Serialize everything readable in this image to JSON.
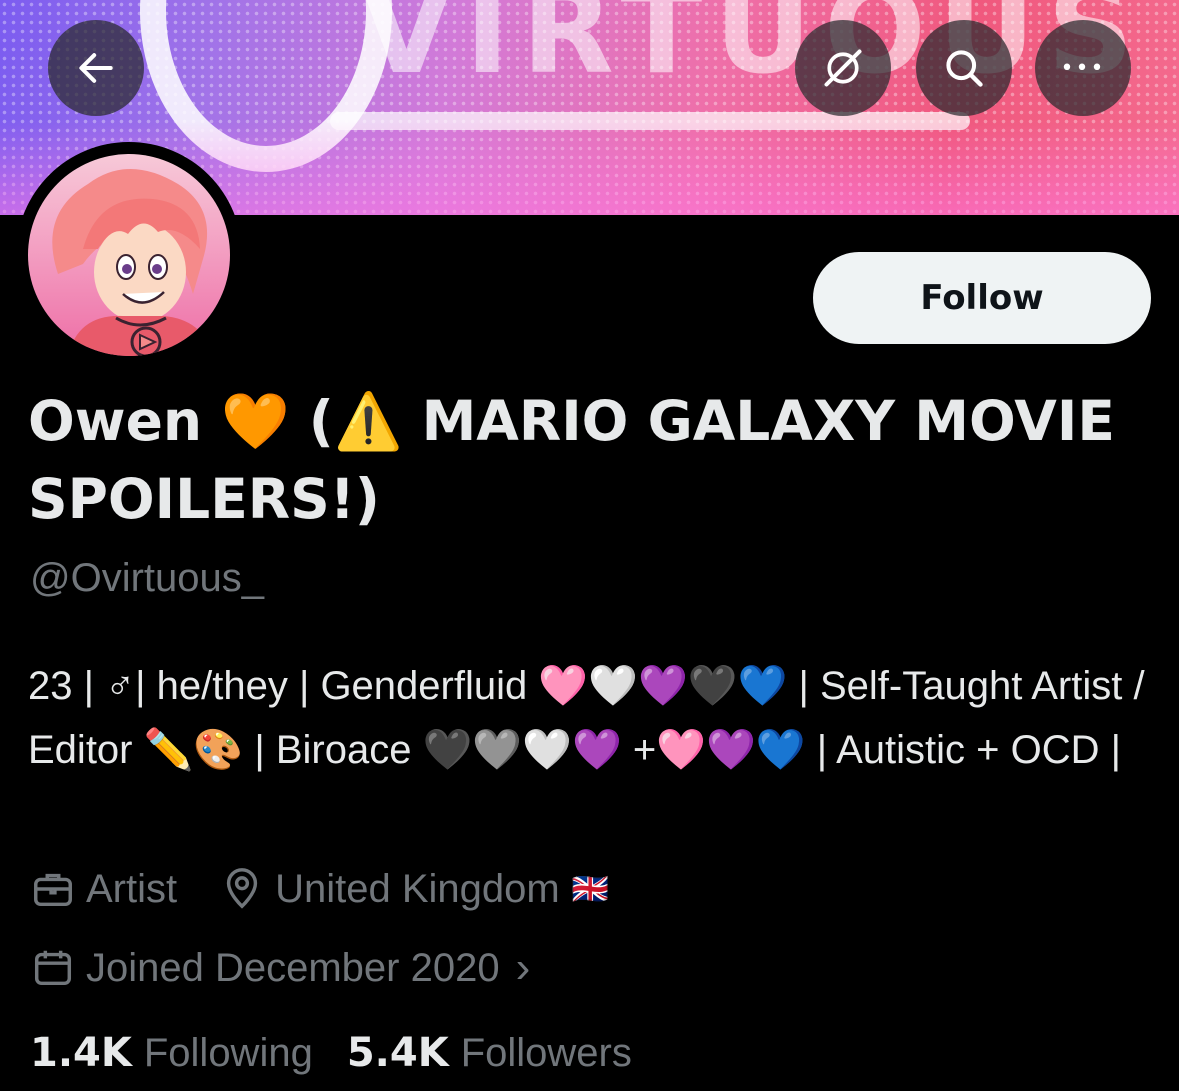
{
  "header": {
    "back_icon": "arrow-left-icon",
    "grok_icon": "grok-icon",
    "search_icon": "search-icon",
    "more_icon": "more-icon",
    "more_label": "•••"
  },
  "banner": {
    "text": "VIRTUOUS"
  },
  "profile": {
    "display_name": "Owen 🧡 (⚠️ MARIO GALAXY MOVIE SPOILERS!)",
    "handle": "@Ovirtuous_",
    "follow_label": "Follow",
    "bio": "23 | ♂| he/they | Genderfluid 🩷🤍💜🖤💙 | Self-Taught Artist / Editor ✏️🎨 | Biroace 🖤🩶🤍💜 +🩷💜💙 | Autistic + OCD |",
    "profession": "Artist",
    "location": "United Kingdom",
    "location_flag": "🇬🇧",
    "joined": "Joined December 2020",
    "joined_chevron": "›",
    "following_count": "1.4K",
    "following_label": "Following",
    "followers_count": "5.4K",
    "followers_label": "Followers"
  },
  "colors": {
    "background": "#000000",
    "text_primary": "#e7e9ea",
    "text_secondary": "#71767b",
    "follow_button_bg": "#eff3f4"
  }
}
